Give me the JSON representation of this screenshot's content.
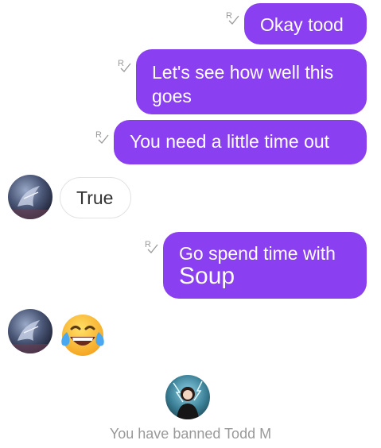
{
  "messages": [
    {
      "dir": "out",
      "text": "Okay tood"
    },
    {
      "dir": "out",
      "text": "Let's see how well this goes"
    },
    {
      "dir": "out",
      "text": "You need a little time out"
    },
    {
      "dir": "in",
      "text": "True"
    },
    {
      "dir": "out",
      "line1": "Go spend time with",
      "line2": "Soup"
    },
    {
      "dir": "in",
      "emoji": "face-with-tears-of-joy"
    }
  ],
  "receipt_icon": "read-receipt-icon",
  "status": "You have banned Todd M",
  "colors": {
    "outgoing_bubble": "#8a3ff0",
    "status_text": "#999999"
  }
}
